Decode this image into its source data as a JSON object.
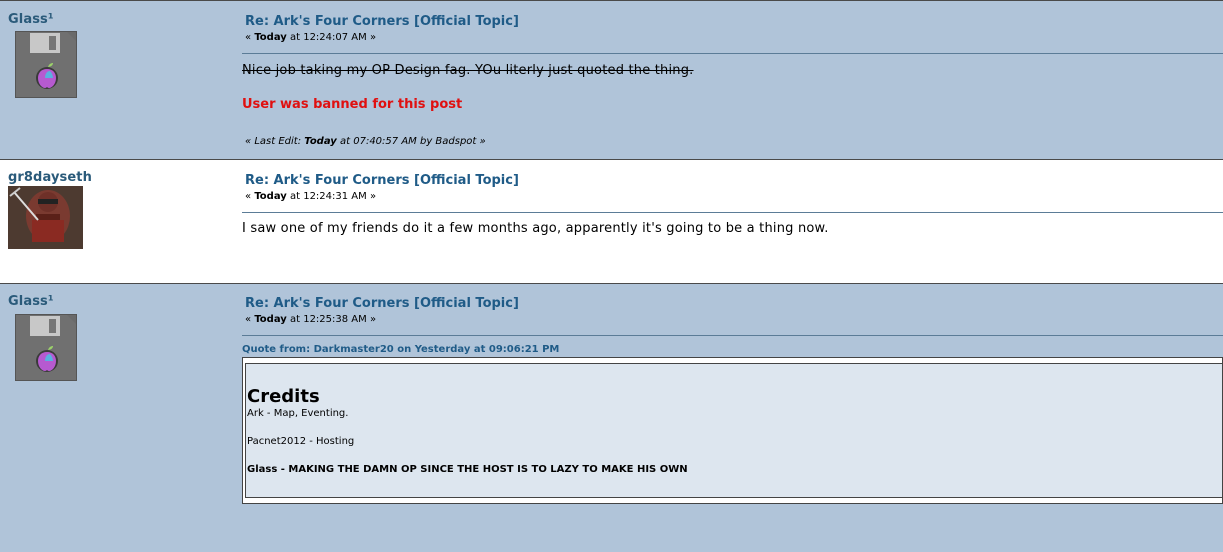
{
  "posts": [
    {
      "author": "Glass¹",
      "avatar_icon": "floppy-disk-apple-icon",
      "subject": "Re: Ark's Four Corners [Official Topic]",
      "date_prefix": "«",
      "date_day": "Today",
      "date_time": "at 12:24:07 AM",
      "date_suffix": "»",
      "body": "Nice job taking my OP Design fag. YOu literly just quoted the thing.",
      "banned_notice": "User was banned for this post",
      "last_edit": {
        "prefix": "« Last Edit:",
        "day": "Today",
        "rest": "at 07:40:57 AM by Badspot »"
      }
    },
    {
      "author": "gr8dayseth",
      "avatar_icon": "character-with-pickaxe-icon",
      "subject": "Re: Ark's Four Corners [Official Topic]",
      "date_prefix": "«",
      "date_day": "Today",
      "date_time": "at 12:24:31 AM",
      "date_suffix": "»",
      "body": "I saw one of my friends do it a few months ago, apparently it's going to be a thing now."
    },
    {
      "author": "Glass¹",
      "avatar_icon": "floppy-disk-apple-icon",
      "subject": "Re: Ark's Four Corners [Official Topic]",
      "date_prefix": "«",
      "date_day": "Today",
      "date_time": "at 12:25:38 AM",
      "date_suffix": "»",
      "quote": {
        "header": "Quote from: Darkmaster20 on Yesterday at 09:06:21 PM",
        "title": "Credits",
        "lines": [
          "Ark - Map, Eventing.",
          "Pacnet2012 - Hosting",
          "Glass - MAKING THE DAMN OP SINCE THE HOST IS TO LAZY TO MAKE HIS OWN"
        ]
      }
    }
  ],
  "colors": {
    "alt_bg": "#b0c4d9",
    "link": "#1f5b87",
    "banned": "#e01010",
    "quote_bg": "#dde6ef"
  }
}
